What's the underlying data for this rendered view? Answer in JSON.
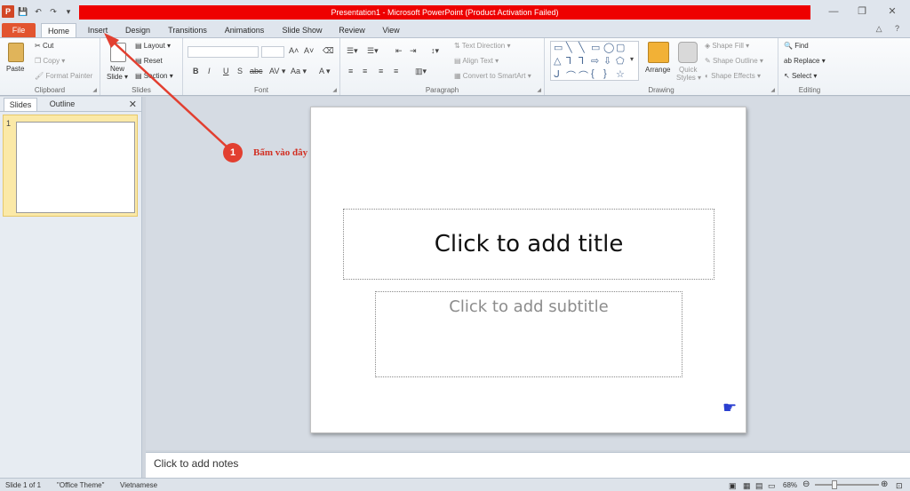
{
  "titlebar": {
    "title": "Presentation1 - Microsoft PowerPoint (Product Activation Failed)",
    "minimize": "—",
    "restore": "❐",
    "close": "✕"
  },
  "qat": [
    "P",
    "💾",
    "↶",
    "↷",
    "▾"
  ],
  "tabs": {
    "file": "File",
    "home": "Home",
    "insert": "Insert",
    "design": "Design",
    "transitions": "Transitions",
    "animations": "Animations",
    "slideshow": "Slide Show",
    "review": "Review",
    "view": "View",
    "help": "△ ?"
  },
  "ribbon": {
    "clipboard": {
      "label": "Clipboard",
      "paste": "Paste",
      "cut": "Cut",
      "copy": "Copy ▾",
      "format_painter": "Format Painter"
    },
    "slides": {
      "label": "Slides",
      "new_slide": "New",
      "new_slide2": "Slide ▾",
      "layout": "Layout ▾",
      "reset": "Reset",
      "section": "Section ▾"
    },
    "font": {
      "label": "Font",
      "bold": "B",
      "italic": "I",
      "underline": "U",
      "strike": "S",
      "abc": "abc",
      "spacing": "AV ▾",
      "case": "Aa ▾",
      "color": "A ▾",
      "grow": "A˄",
      "shrink": "A˅"
    },
    "paragraph": {
      "label": "Paragraph",
      "text_direction": "Text Direction ▾",
      "align_text": "Align Text ▾",
      "smartart": "Convert to SmartArt ▾"
    },
    "drawing": {
      "label": "Drawing",
      "arrange": "Arrange",
      "quick_styles": "Quick",
      "quick_styles2": "Styles ▾",
      "shape_fill": "Shape Fill ▾",
      "shape_outline": "Shape Outline ▾",
      "shape_effects": "Shape Effects ▾"
    },
    "editing": {
      "label": "Editing",
      "find": "Find",
      "replace": "Replace ▾",
      "select": "Select ▾"
    }
  },
  "left_pane": {
    "tab_slides": "Slides",
    "tab_outline": "Outline",
    "close": "✕",
    "slide_number": "1"
  },
  "slide": {
    "title_placeholder": "Click to add title",
    "subtitle_placeholder": "Click to add subtitle"
  },
  "annotation": {
    "step_number": "1",
    "text": "Bấm vào đây"
  },
  "notes": {
    "placeholder": "Click to add notes"
  },
  "status": {
    "slide_info": "Slide 1 of 1",
    "theme": "\"Office Theme\"",
    "language": "Vietnamese",
    "zoom": "68%",
    "zoom_out": "⊖",
    "zoom_in": "⊕"
  },
  "colors": {
    "title_bar_red": "#ee0000",
    "file_tab": "#e2542f",
    "annotation_red": "#e23f30",
    "cursor_blue": "#2a3fd0"
  }
}
